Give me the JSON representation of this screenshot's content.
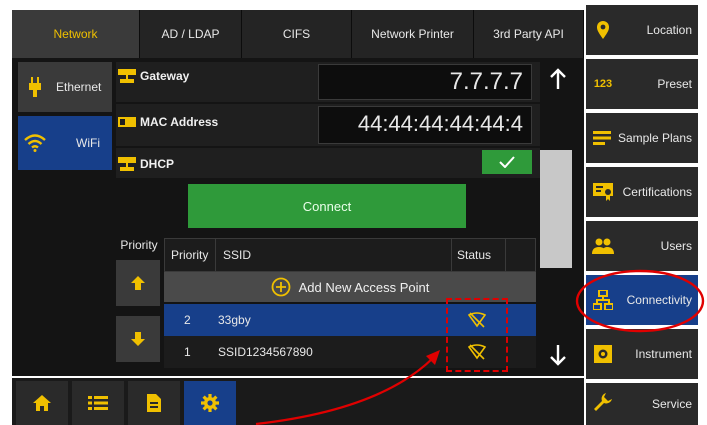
{
  "tabs": [
    "Network",
    "AD / LDAP",
    "CIFS",
    "Network Printer",
    "3rd Party API"
  ],
  "left_nav": {
    "ethernet": "Ethernet",
    "wifi": "WiFi"
  },
  "fields": {
    "gateway_label": "Gateway",
    "gateway_value": "7.7.7.7",
    "mac_label": "MAC Address",
    "mac_value": "44:44:44:44:44:4",
    "dhcp_label": "DHCP",
    "dhcp_checked": true
  },
  "connect_label": "Connect",
  "priority_label": "Priority",
  "table": {
    "columns": [
      "Priority",
      "SSID",
      "Status"
    ],
    "add_label": "Add New Access Point",
    "rows": [
      {
        "priority": "2",
        "ssid": "33gby"
      },
      {
        "priority": "1",
        "ssid": "SSID1234567890"
      }
    ]
  },
  "right_nav": [
    {
      "label": "Location",
      "icon": "location-pin-icon"
    },
    {
      "label": "Preset",
      "icon": "numbers-icon"
    },
    {
      "label": "Sample Plans",
      "icon": "list-icon"
    },
    {
      "label": "Certifications",
      "icon": "certificate-icon"
    },
    {
      "label": "Users",
      "icon": "users-icon"
    },
    {
      "label": "Connectivity",
      "icon": "network-icon"
    },
    {
      "label": "Instrument",
      "icon": "instrument-icon"
    },
    {
      "label": "Service",
      "icon": "wrench-icon"
    }
  ],
  "colors": {
    "accent_yellow": "#f0c000",
    "active_blue": "#173f8a",
    "green": "#2f9a3a",
    "annotation_red": "#e00000"
  }
}
